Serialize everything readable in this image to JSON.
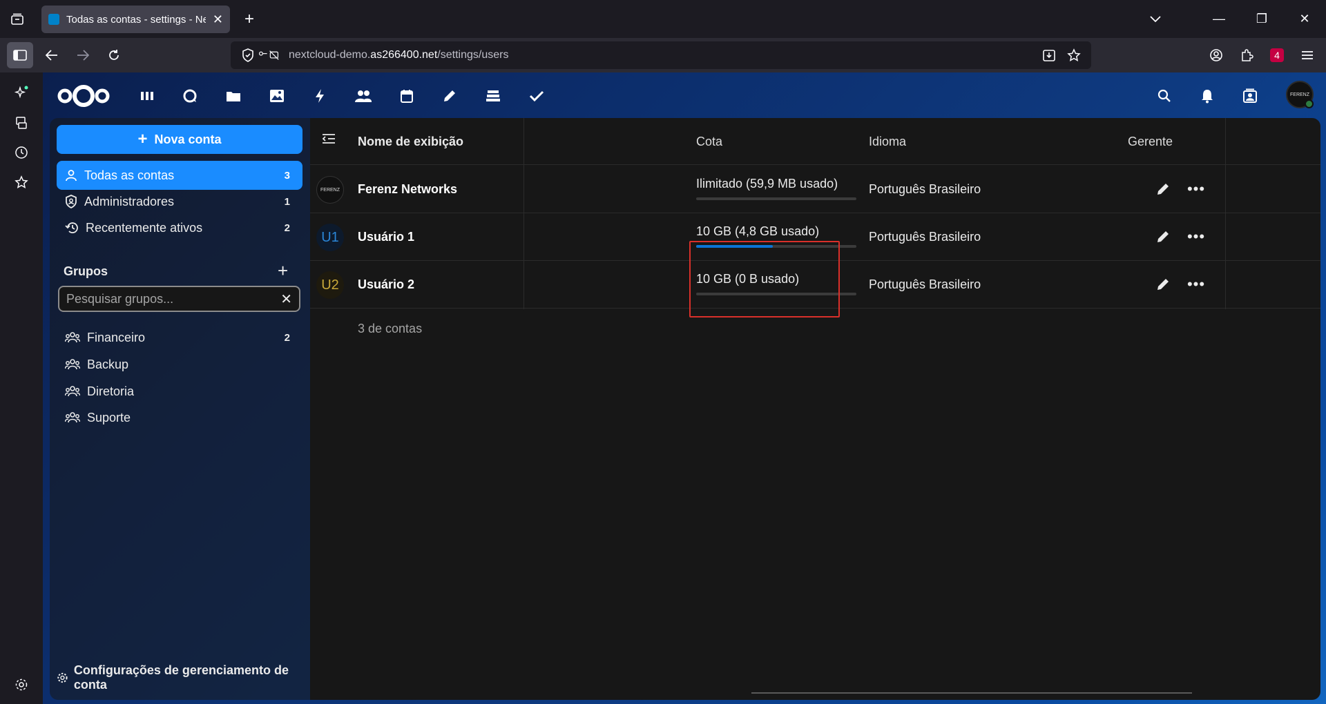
{
  "browser": {
    "tab_title": "Todas as contas - settings - Nex",
    "url_plain": "nextcloud-demo.",
    "url_domain": "as266400.net",
    "url_path": "/settings/users",
    "extension_badge": "4"
  },
  "nav": {
    "new_account_label": "Nova conta",
    "items": [
      {
        "label": "Todas as contas",
        "count": "3"
      },
      {
        "label": "Administradores",
        "count": "1"
      },
      {
        "label": "Recentemente ativos",
        "count": "2"
      }
    ],
    "groups_title": "Grupos",
    "group_search_placeholder": "Pesquisar grupos...",
    "groups": [
      {
        "label": "Financeiro",
        "count": "2"
      },
      {
        "label": "Backup",
        "count": ""
      },
      {
        "label": "Diretoria",
        "count": ""
      },
      {
        "label": "Suporte",
        "count": ""
      }
    ],
    "footer_label": "Configurações de gerenciamento de conta"
  },
  "table": {
    "headers": {
      "display_name": "Nome de exibição",
      "quota": "Cota",
      "language": "Idioma",
      "manager": "Gerente"
    },
    "rows": [
      {
        "avatar": "",
        "name": "Ferenz Networks",
        "quota": "Ilimitado (59,9 MB usado)",
        "quota_used_fraction": 0.0,
        "language": "Português Brasileiro"
      },
      {
        "avatar": "U1",
        "name": "Usuário 1",
        "quota": "10 GB (4,8 GB usado)",
        "quota_used_fraction": 0.48,
        "language": "Português Brasileiro"
      },
      {
        "avatar": "U2",
        "name": "Usuário 2",
        "quota": "10 GB (0 B usado)",
        "quota_used_fraction": 0.0,
        "language": "Português Brasileiro"
      }
    ],
    "accounts_count": "3 de contas"
  },
  "colors": {
    "primary": "#1a8cff",
    "u1": "#2a86d8",
    "u2": "#c9a93a",
    "highlight": "#d9302a"
  }
}
